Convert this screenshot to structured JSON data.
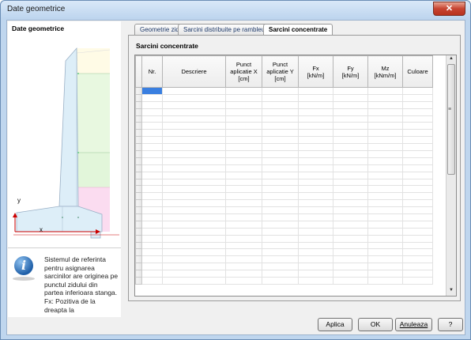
{
  "window": {
    "title": "Date geometrice",
    "close_label": "✕"
  },
  "left_panel": {
    "title": "Date geometrice",
    "axis_y": "y",
    "axis_x": "x",
    "info_icon": "info-icon",
    "info_text": "Sistemul de referinta pentru asignarea sarcinilor are originea pe punctul zidului din partea inferioara stanga. Fx: Pozitiva de la dreapta la"
  },
  "tabs": [
    {
      "label": "Geometrie zid"
    },
    {
      "label": "Sarcini distribuite pe rambleu"
    },
    {
      "label": "Sarcini concentrate"
    }
  ],
  "panel": {
    "title": "Sarcini concentrate",
    "columns": [
      [
        "Nr."
      ],
      [
        "Descriere"
      ],
      [
        "Punct",
        "aplicatie X",
        "[cm]"
      ],
      [
        "Punct",
        "aplicatie Y",
        "[cm]"
      ],
      [
        "Fx",
        "[kN/m]"
      ],
      [
        "Fy",
        "[kN/m]"
      ],
      [
        "Mz",
        "[kNm/m]"
      ],
      [
        "Culoare"
      ]
    ]
  },
  "buttons": {
    "apply": "Aplica",
    "ok": "OK",
    "cancel": "Anuleaza",
    "help": "?"
  },
  "colors": {
    "selection": "#3a7fe0",
    "window_frame": "#bfd6ee"
  }
}
